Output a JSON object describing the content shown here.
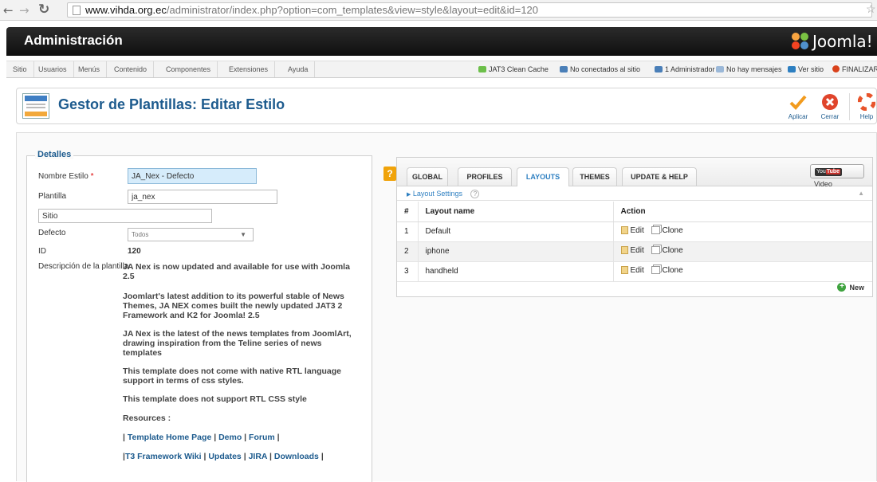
{
  "browser": {
    "url_host": "www.vihda.org.ec",
    "url_path": "/administrator/index.php?option=com_templates&view=style&layout=edit&id=120"
  },
  "header": {
    "title": "Administración",
    "logo_text": "Joomla!"
  },
  "menu": {
    "items": [
      "Sitio",
      "Usuarios",
      "Menús",
      "Contenido",
      "Componentes",
      "Extensiones",
      "Ayuda"
    ]
  },
  "status": {
    "cache": "JAT3 Clean Cache",
    "not_connected": "No conectados al sitio",
    "admins": "1 Administrador",
    "messages": "No hay mensajes",
    "view_site": "Ver sitio",
    "logout": "FINALIZAR"
  },
  "toolbar": {
    "title": "Gestor de Plantillas: Editar Estilo",
    "apply": "Aplicar",
    "close": "Cerrar",
    "help": "Help"
  },
  "details": {
    "legend": "Detalles",
    "style_name_label": "Nombre Estilo",
    "required_mark": "*",
    "style_name_value": "JA_Nex - Defecto",
    "template_label": "Plantilla",
    "template_value": "ja_nex",
    "site_value": "Sitio",
    "default_label": "Defecto",
    "default_value": "Todos",
    "id_label": "ID",
    "id_value": "120",
    "description_label": "Descripción de la plantilla",
    "description": [
      "JA Nex is now updated and available for use with Joomla 2.5",
      "Joomlart's latest addition to its powerful stable of News Themes, JA NEX comes built the newly updated JAT3 2 Framework and K2 for Joomla! 2.5",
      "JA Nex is the latest of the news templates from JoomlArt, drawing inspiration from the Teline series of news templates",
      "This template does not come with native RTL language support in terms of css styles.",
      "This template does not support RTL CSS style",
      "Resources :"
    ],
    "links_row1": [
      "Template Home Page",
      "Demo",
      "Forum"
    ],
    "links_row2": [
      "T3 Framework Wiki",
      "Updates",
      "JIRA",
      "Downloads"
    ]
  },
  "panel": {
    "help_mark": "?",
    "tabs": [
      "GLOBAL",
      "PROFILES",
      "LAYOUTS",
      "THEMES",
      "UPDATE & HELP"
    ],
    "active_tab": "LAYOUTS",
    "video": "Video",
    "youtube_you": "You",
    "youtube_tube": "Tube",
    "layout_settings": "Layout Settings",
    "layout_settings_help": "?",
    "columns": [
      "#",
      "Layout name",
      "Action"
    ],
    "rows": [
      {
        "num": "1",
        "name": "Default"
      },
      {
        "num": "2",
        "name": "iphone"
      },
      {
        "num": "3",
        "name": "handheld"
      }
    ],
    "edit_label": "Edit",
    "clone_label": "Clone",
    "new_label": "New"
  }
}
